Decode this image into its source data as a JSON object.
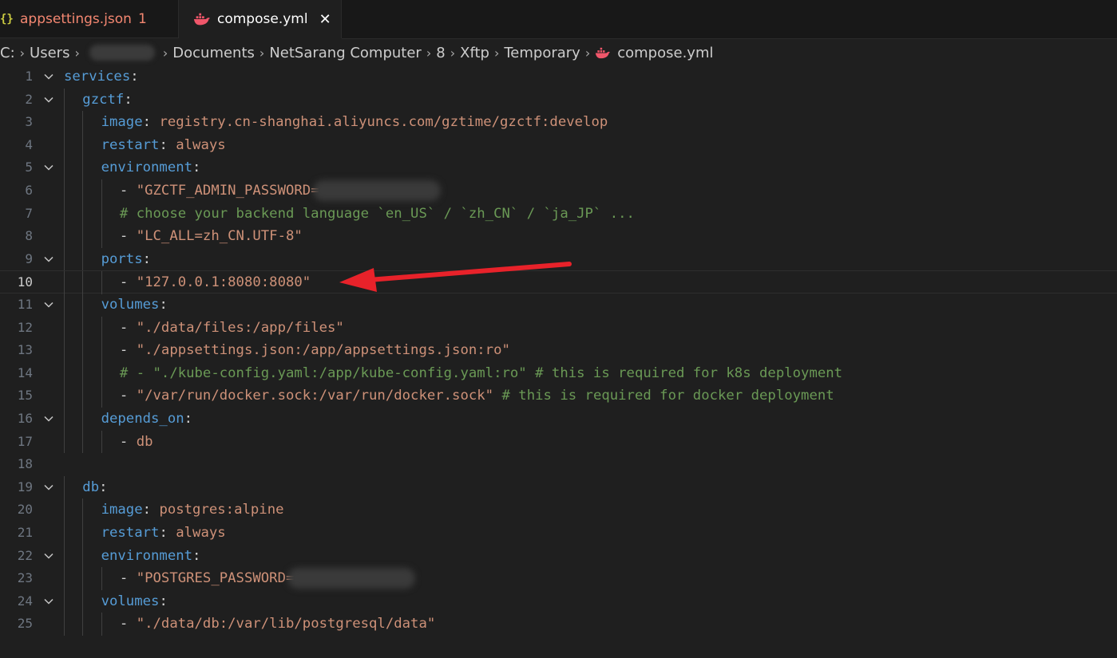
{
  "tabs": [
    {
      "label": "appsettings.json",
      "badge": "1",
      "icon": "json-icon",
      "active": false
    },
    {
      "label": "compose.yml",
      "icon": "docker-icon",
      "active": true
    }
  ],
  "breadcrumb": [
    "C:",
    "Users",
    "Documents",
    "NetSarang Computer",
    "8",
    "Xftp",
    "Temporary",
    "compose.yml"
  ],
  "editor": {
    "current_line": 10,
    "lines": [
      {
        "n": "1",
        "fold": true,
        "indent": 0,
        "segs": [
          [
            "k",
            "services"
          ],
          [
            "p",
            ":"
          ]
        ]
      },
      {
        "n": "2",
        "fold": true,
        "indent": 1,
        "segs": [
          [
            "k",
            "gzctf"
          ],
          [
            "p",
            ":"
          ]
        ]
      },
      {
        "n": "3",
        "fold": false,
        "indent": 2,
        "segs": [
          [
            "k",
            "image"
          ],
          [
            "p",
            ": "
          ],
          [
            "s",
            "registry.cn-shanghai.aliyuncs.com/gztime/gzctf:develop"
          ]
        ]
      },
      {
        "n": "4",
        "fold": false,
        "indent": 2,
        "segs": [
          [
            "k",
            "restart"
          ],
          [
            "p",
            ": "
          ],
          [
            "s",
            "always"
          ]
        ]
      },
      {
        "n": "5",
        "fold": true,
        "indent": 2,
        "segs": [
          [
            "k",
            "environment"
          ],
          [
            "p",
            ":"
          ]
        ]
      },
      {
        "n": "6",
        "fold": false,
        "indent": 3,
        "segs": [
          [
            "p",
            "- "
          ],
          [
            "s",
            "\"GZCTF_ADMIN_PASSWORD="
          ],
          [
            "blur",
            ""
          ]
        ]
      },
      {
        "n": "7",
        "fold": false,
        "indent": 3,
        "segs": [
          [
            "c",
            "# choose your backend language `en_US` / `zh_CN` / `ja_JP` ..."
          ]
        ]
      },
      {
        "n": "8",
        "fold": false,
        "indent": 3,
        "segs": [
          [
            "p",
            "- "
          ],
          [
            "s",
            "\"LC_ALL=zh_CN.UTF-8\""
          ]
        ]
      },
      {
        "n": "9",
        "fold": true,
        "indent": 2,
        "segs": [
          [
            "k",
            "ports"
          ],
          [
            "p",
            ":"
          ]
        ]
      },
      {
        "n": "10",
        "fold": false,
        "indent": 3,
        "segs": [
          [
            "p",
            "- "
          ],
          [
            "s",
            "\"127.0.0.1:8080:8080\""
          ]
        ]
      },
      {
        "n": "11",
        "fold": true,
        "indent": 2,
        "segs": [
          [
            "k",
            "volumes"
          ],
          [
            "p",
            ":"
          ]
        ]
      },
      {
        "n": "12",
        "fold": false,
        "indent": 3,
        "segs": [
          [
            "p",
            "- "
          ],
          [
            "s",
            "\"./data/files:/app/files\""
          ]
        ]
      },
      {
        "n": "13",
        "fold": false,
        "indent": 3,
        "segs": [
          [
            "p",
            "- "
          ],
          [
            "s",
            "\"./appsettings.json:/app/appsettings.json:ro\""
          ]
        ]
      },
      {
        "n": "14",
        "fold": false,
        "indent": 3,
        "segs": [
          [
            "c",
            "# - \"./kube-config.yaml:/app/kube-config.yaml:ro\" # this is required for k8s deployment"
          ]
        ]
      },
      {
        "n": "15",
        "fold": false,
        "indent": 3,
        "segs": [
          [
            "p",
            "- "
          ],
          [
            "s",
            "\"/var/run/docker.sock:/var/run/docker.sock\""
          ],
          [
            "c",
            " # this is required for docker deployment"
          ]
        ]
      },
      {
        "n": "16",
        "fold": true,
        "indent": 2,
        "segs": [
          [
            "k",
            "depends_on"
          ],
          [
            "p",
            ":"
          ]
        ]
      },
      {
        "n": "17",
        "fold": false,
        "indent": 3,
        "segs": [
          [
            "p",
            "- "
          ],
          [
            "s",
            "db"
          ]
        ]
      },
      {
        "n": "18",
        "fold": false,
        "indent": 0,
        "segs": []
      },
      {
        "n": "19",
        "fold": true,
        "indent": 1,
        "segs": [
          [
            "k",
            "db"
          ],
          [
            "p",
            ":"
          ]
        ]
      },
      {
        "n": "20",
        "fold": false,
        "indent": 2,
        "segs": [
          [
            "k",
            "image"
          ],
          [
            "p",
            ": "
          ],
          [
            "s",
            "postgres:alpine"
          ]
        ]
      },
      {
        "n": "21",
        "fold": false,
        "indent": 2,
        "segs": [
          [
            "k",
            "restart"
          ],
          [
            "p",
            ": "
          ],
          [
            "s",
            "always"
          ]
        ]
      },
      {
        "n": "22",
        "fold": true,
        "indent": 2,
        "segs": [
          [
            "k",
            "environment"
          ],
          [
            "p",
            ":"
          ]
        ]
      },
      {
        "n": "23",
        "fold": false,
        "indent": 3,
        "segs": [
          [
            "p",
            "- "
          ],
          [
            "s",
            "\"POSTGRES_PASSWORD="
          ],
          [
            "blur",
            ""
          ]
        ]
      },
      {
        "n": "24",
        "fold": true,
        "indent": 2,
        "segs": [
          [
            "k",
            "volumes"
          ],
          [
            "p",
            ":"
          ]
        ]
      },
      {
        "n": "25",
        "fold": false,
        "indent": 3,
        "segs": [
          [
            "p",
            "- "
          ],
          [
            "s",
            "\"./data/db:/var/lib/postgresql/data\""
          ]
        ]
      }
    ]
  },
  "colors": {
    "keyword": "#569cd6",
    "string": "#ce9178",
    "comment": "#6a9955",
    "arrow": "#e8222a",
    "tab_error": "#f48771"
  }
}
